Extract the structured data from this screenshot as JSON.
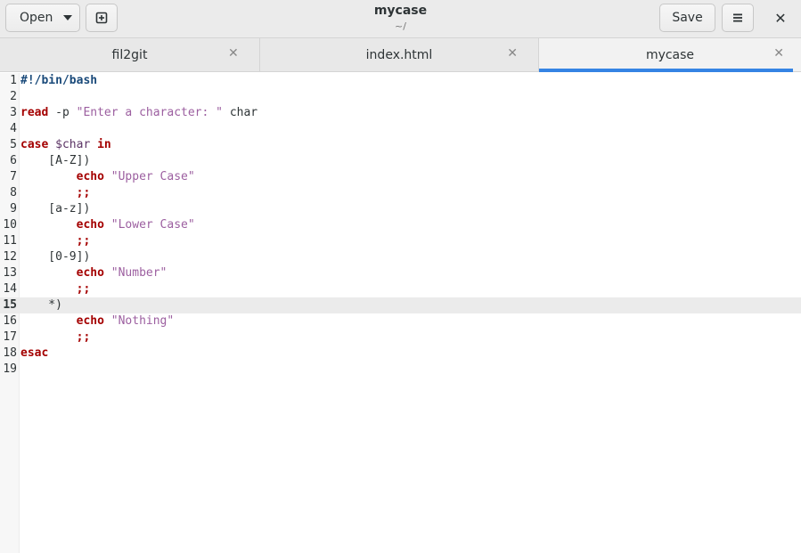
{
  "header": {
    "open_label": "Open",
    "title": "mycase",
    "subtitle": "~/",
    "save_label": "Save",
    "close_glyph": "✕"
  },
  "tabs": [
    {
      "label": "fil2git",
      "active": false
    },
    {
      "label": "index.html",
      "active": false
    },
    {
      "label": "mycase",
      "active": true
    }
  ],
  "editor": {
    "current_line": 15,
    "lines": [
      {
        "n": "1",
        "t": [
          [
            "sb",
            "#!/bin/bash"
          ]
        ]
      },
      {
        "n": "2",
        "t": []
      },
      {
        "n": "3",
        "t": [
          [
            "kw",
            "read"
          ],
          [
            "pl",
            " -p "
          ],
          [
            "str",
            "\"Enter a character: \""
          ],
          [
            "pl",
            " char"
          ]
        ]
      },
      {
        "n": "4",
        "t": []
      },
      {
        "n": "5",
        "t": [
          [
            "kw",
            "case"
          ],
          [
            "pl",
            " "
          ],
          [
            "var",
            "$char"
          ],
          [
            "pl",
            " "
          ],
          [
            "kw",
            "in"
          ]
        ]
      },
      {
        "n": "6",
        "t": [
          [
            "pl",
            "    [A-Z])"
          ]
        ]
      },
      {
        "n": "7",
        "t": [
          [
            "pl",
            "        "
          ],
          [
            "kw",
            "echo"
          ],
          [
            "pl",
            " "
          ],
          [
            "str",
            "\"Upper Case\""
          ]
        ]
      },
      {
        "n": "8",
        "t": [
          [
            "pl",
            "        "
          ],
          [
            "kw",
            ";;"
          ]
        ]
      },
      {
        "n": "9",
        "t": [
          [
            "pl",
            "    [a-z])"
          ]
        ]
      },
      {
        "n": "10",
        "t": [
          [
            "pl",
            "        "
          ],
          [
            "kw",
            "echo"
          ],
          [
            "pl",
            " "
          ],
          [
            "str",
            "\"Lower Case\""
          ]
        ]
      },
      {
        "n": "11",
        "t": [
          [
            "pl",
            "        "
          ],
          [
            "kw",
            ";;"
          ]
        ]
      },
      {
        "n": "12",
        "t": [
          [
            "pl",
            "    [0-9])"
          ]
        ]
      },
      {
        "n": "13",
        "t": [
          [
            "pl",
            "        "
          ],
          [
            "kw",
            "echo"
          ],
          [
            "pl",
            " "
          ],
          [
            "str",
            "\"Number\""
          ]
        ]
      },
      {
        "n": "14",
        "t": [
          [
            "pl",
            "        "
          ],
          [
            "kw",
            ";;"
          ]
        ]
      },
      {
        "n": "15",
        "t": [
          [
            "pl",
            "    *)"
          ]
        ]
      },
      {
        "n": "16",
        "t": [
          [
            "pl",
            "        "
          ],
          [
            "kw",
            "echo"
          ],
          [
            "pl",
            " "
          ],
          [
            "str",
            "\"Nothing\""
          ]
        ]
      },
      {
        "n": "17",
        "t": [
          [
            "pl",
            "        "
          ],
          [
            "kw",
            ";;"
          ]
        ]
      },
      {
        "n": "18",
        "t": [
          [
            "kw",
            "esac"
          ]
        ]
      },
      {
        "n": "19",
        "t": []
      }
    ]
  }
}
